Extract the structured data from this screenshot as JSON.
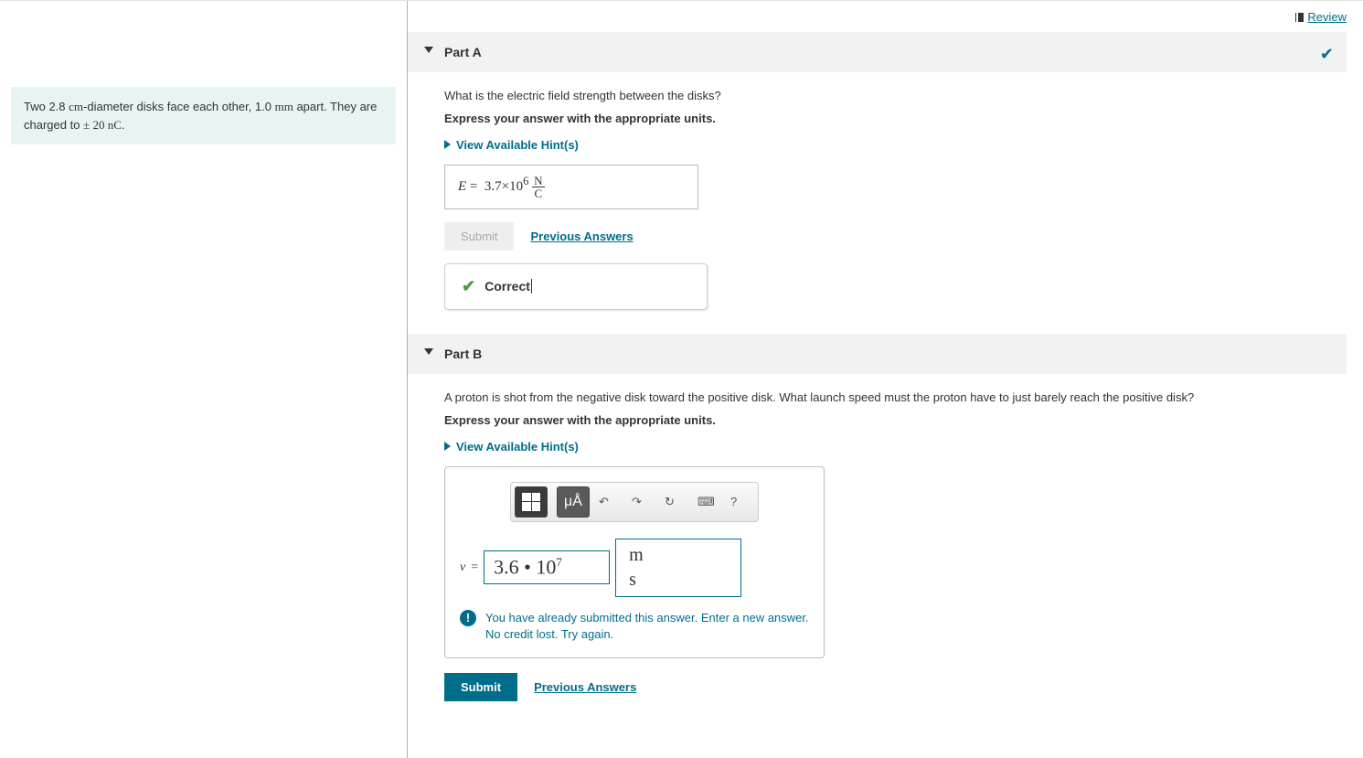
{
  "review_label": "Review",
  "problem": {
    "line1_prefix": "Two 2.8 ",
    "unit1": "cm",
    "line1_mid": "-diameter disks face each other, 1.0 ",
    "unit2": "mm",
    "line1_suffix": " apart. They are charged to ",
    "pm": "±",
    "charge_val": " 20 ",
    "charge_unit": "nC",
    "period": "."
  },
  "partA": {
    "title": "Part A",
    "question": "What is the electric field strength between the disks?",
    "instruction": "Express your answer with the appropriate units.",
    "hints_label": "View Available Hint(s)",
    "answer_var": "E",
    "answer_eq": " = ",
    "answer_val": "3.7×10",
    "answer_exp": "6",
    "unit_num": "N",
    "unit_den": "C",
    "submit_label": "Submit",
    "prev_label": "Previous Answers",
    "feedback": "Correct"
  },
  "partB": {
    "title": "Part B",
    "question": "A proton is shot from the negative disk toward the positive disk. What launch speed must the proton have to just barely reach the positive disk?",
    "instruction": "Express your answer with the appropriate units.",
    "hints_label": "View Available Hint(s)",
    "toolbar": {
      "units_btn": "μÅ",
      "undo": "↶",
      "redo": "↷",
      "reset": "↻",
      "keyboard": "⌨",
      "help": "?"
    },
    "answer_var": "v",
    "answer_eq": " = ",
    "answer_val_base": "3.6 • 10",
    "answer_val_exp": "7",
    "unit_num": "m",
    "unit_den": "s",
    "warn_line1": "You have already submitted this answer. Enter a new answer.",
    "warn_line2": "No credit lost. Try again.",
    "submit_label": "Submit",
    "prev_label": "Previous Answers"
  }
}
